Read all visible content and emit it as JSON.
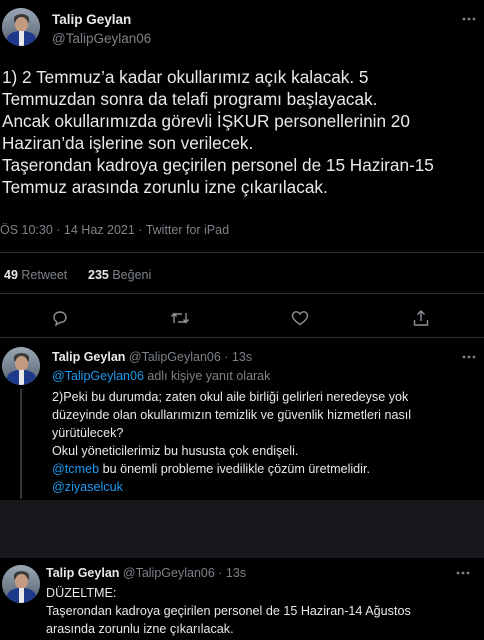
{
  "main_tweet": {
    "author_name": "Talip Geylan",
    "author_handle": "@TalipGeylan06",
    "lines": [
      "1) 2 Temmuz’a kadar okullarımız açık kalacak. 5",
      "Temmuzdan sonra da telafi programı başlayacak.",
      "Ancak okullarımızda görevli İŞKUR personellerinin 20",
      "Haziran’da işlerine son verilecek.",
      "Taşerondan kadroya geçirilen personel de 15 Haziran-15",
      "Temmuz arasında zorunlu izne çıkarılacak."
    ],
    "meta": "ÖS 10:30 · 14 Haz 2021 · Twitter for iPad",
    "retweet_count": "49",
    "retweet_label": "Retweet",
    "like_count": "235",
    "like_label": "Beğeni"
  },
  "reply1": {
    "author_name": "Talip Geylan",
    "author_handle": "@TalipGeylan06",
    "time": "· 13s",
    "reply_to_handle": "@TalipGeylan06",
    "reply_to_suffix": "adlı kişiye yanıt olarak",
    "lines": [
      "2)Peki bu durumda; zaten okul aile birliği gelirleri neredeyse yok",
      "düzeyinde olan okullarımızın temizlik ve güvenlik hizmetleri nasıl",
      "yürütülecek?",
      "Okul yöneticilerimiz bu hususta çok endişeli."
    ],
    "mention1": "@tcmeb",
    "mention1_suffix": "bu önemli probleme ivedilikle çözüm üretmelidir.",
    "mention2": "@ziyaselcuk"
  },
  "reply2": {
    "author_name": "Talip Geylan",
    "author_handle": "@TalipGeylan06",
    "time": "· 13s",
    "lines": [
      "DÜZELTME:",
      "Taşerondan kadroya geçirilen personel de 15 Haziran-14 Ağustos",
      "arasında zorunlu izne çıkarılacak."
    ]
  },
  "colors": {
    "background": "#000000",
    "text": "#e7e9ea",
    "muted": "#7c8288",
    "link": "#1d9bf0"
  },
  "icons": [
    "more-icon",
    "reply-icon",
    "retweet-icon",
    "like-icon",
    "share-icon"
  ]
}
